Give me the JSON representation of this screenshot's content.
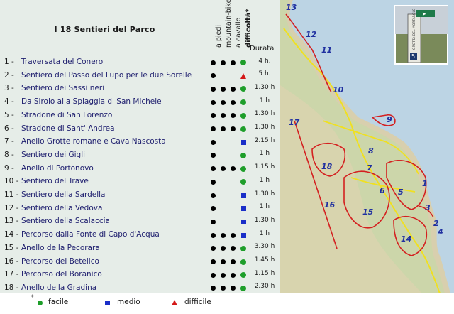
{
  "table": {
    "title": "I 18 Sentieri del Parco",
    "headers": {
      "a_piedi": "a piedi",
      "mountain_bike": "mountain-bike",
      "a_cavallo": "a cavallo",
      "difficolta": "difficoltà*",
      "durata": "Durata"
    },
    "rows": [
      {
        "num": "1 -",
        "name": "Traversata del Conero",
        "piedi": true,
        "bike": true,
        "cavallo": true,
        "diff": "facile",
        "durata": "4 h."
      },
      {
        "num": "2 -",
        "name": "Sentiero del Passo del Lupo per le due Sorelle",
        "piedi": true,
        "bike": false,
        "cavallo": false,
        "diff": "difficile",
        "durata": "5 h."
      },
      {
        "num": "3 -",
        "name": "Sentiero dei Sassi neri",
        "piedi": true,
        "bike": true,
        "cavallo": true,
        "diff": "facile",
        "durata": "1.30 h"
      },
      {
        "num": "4 -",
        "name": "Da Sirolo alla Spiaggia di San Michele",
        "piedi": true,
        "bike": true,
        "cavallo": true,
        "diff": "facile",
        "durata": "1 h"
      },
      {
        "num": "5 -",
        "name": "Stradone di San Lorenzo",
        "piedi": true,
        "bike": true,
        "cavallo": true,
        "diff": "facile",
        "durata": "1.30 h"
      },
      {
        "num": "6 -",
        "name": "Stradone di Sant' Andrea",
        "piedi": true,
        "bike": true,
        "cavallo": true,
        "diff": "facile",
        "durata": "1.30 h"
      },
      {
        "num": "7 -",
        "name": "Anello Grotte romane e Cava Nascosta",
        "piedi": true,
        "bike": false,
        "cavallo": false,
        "diff": "medio",
        "durata": "2.15 h"
      },
      {
        "num": "8 -",
        "name": "Sentiero dei Gigli",
        "piedi": true,
        "bike": false,
        "cavallo": false,
        "diff": "facile",
        "durata": "1 h"
      },
      {
        "num": "9 -",
        "name": "Anello di Portonovo",
        "piedi": true,
        "bike": true,
        "cavallo": true,
        "diff": "facile",
        "durata": "1.15 h"
      },
      {
        "num": "10 -",
        "name": "Sentiero del Trave",
        "piedi": true,
        "bike": false,
        "cavallo": false,
        "diff": "facile",
        "durata": "1 h"
      },
      {
        "num": "11 -",
        "name": "Sentiero della Sardella",
        "piedi": true,
        "bike": false,
        "cavallo": false,
        "diff": "medio",
        "durata": "1.30 h"
      },
      {
        "num": "12 -",
        "name": "Sentiero della Vedova",
        "piedi": true,
        "bike": false,
        "cavallo": false,
        "diff": "medio",
        "durata": "1 h"
      },
      {
        "num": "13 -",
        "name": "Sentiero della Scalaccia",
        "piedi": true,
        "bike": false,
        "cavallo": false,
        "diff": "medio",
        "durata": "1.30 h"
      },
      {
        "num": "14 -",
        "name": "Percorso dalla Fonte di Capo d'Acqua",
        "piedi": true,
        "bike": true,
        "cavallo": true,
        "diff": "medio",
        "durata": "1 h"
      },
      {
        "num": "15 -",
        "name": "Anello della Pecorara",
        "piedi": true,
        "bike": true,
        "cavallo": true,
        "diff": "facile",
        "durata": "3.30 h"
      },
      {
        "num": "16 -",
        "name": "Percorso del Betelico",
        "piedi": true,
        "bike": true,
        "cavallo": true,
        "diff": "facile",
        "durata": "1.45 h"
      },
      {
        "num": "17 -",
        "name": "Percorso del Boranico",
        "piedi": true,
        "bike": true,
        "cavallo": true,
        "diff": "facile",
        "durata": "1.15 h"
      },
      {
        "num": "18 -",
        "name": "Anello della Gradina",
        "piedi": true,
        "bike": true,
        "cavallo": true,
        "diff": "facile",
        "durata": "2.30 h"
      }
    ]
  },
  "legend": {
    "star": "*",
    "facile": "facile",
    "medio": "medio",
    "difficile": "difficile"
  },
  "map": {
    "labels": [
      "13",
      "12",
      "11",
      "10",
      "17",
      "9",
      "8",
      "18",
      "7",
      "1",
      "6",
      "5",
      "16",
      "15",
      "3",
      "2",
      "14",
      "4"
    ],
    "photo_text": [
      "GROTTA DEL MORTAROLO",
      "5"
    ]
  },
  "colors": {
    "facile": "#1e9e2a",
    "medio": "#1a2ec8",
    "difficile": "#d41818",
    "trail_name": "#1e1e6e",
    "panel_bg": "#e6ede8",
    "trail_red": "#d42020",
    "trail_yellow": "#f0e020"
  }
}
